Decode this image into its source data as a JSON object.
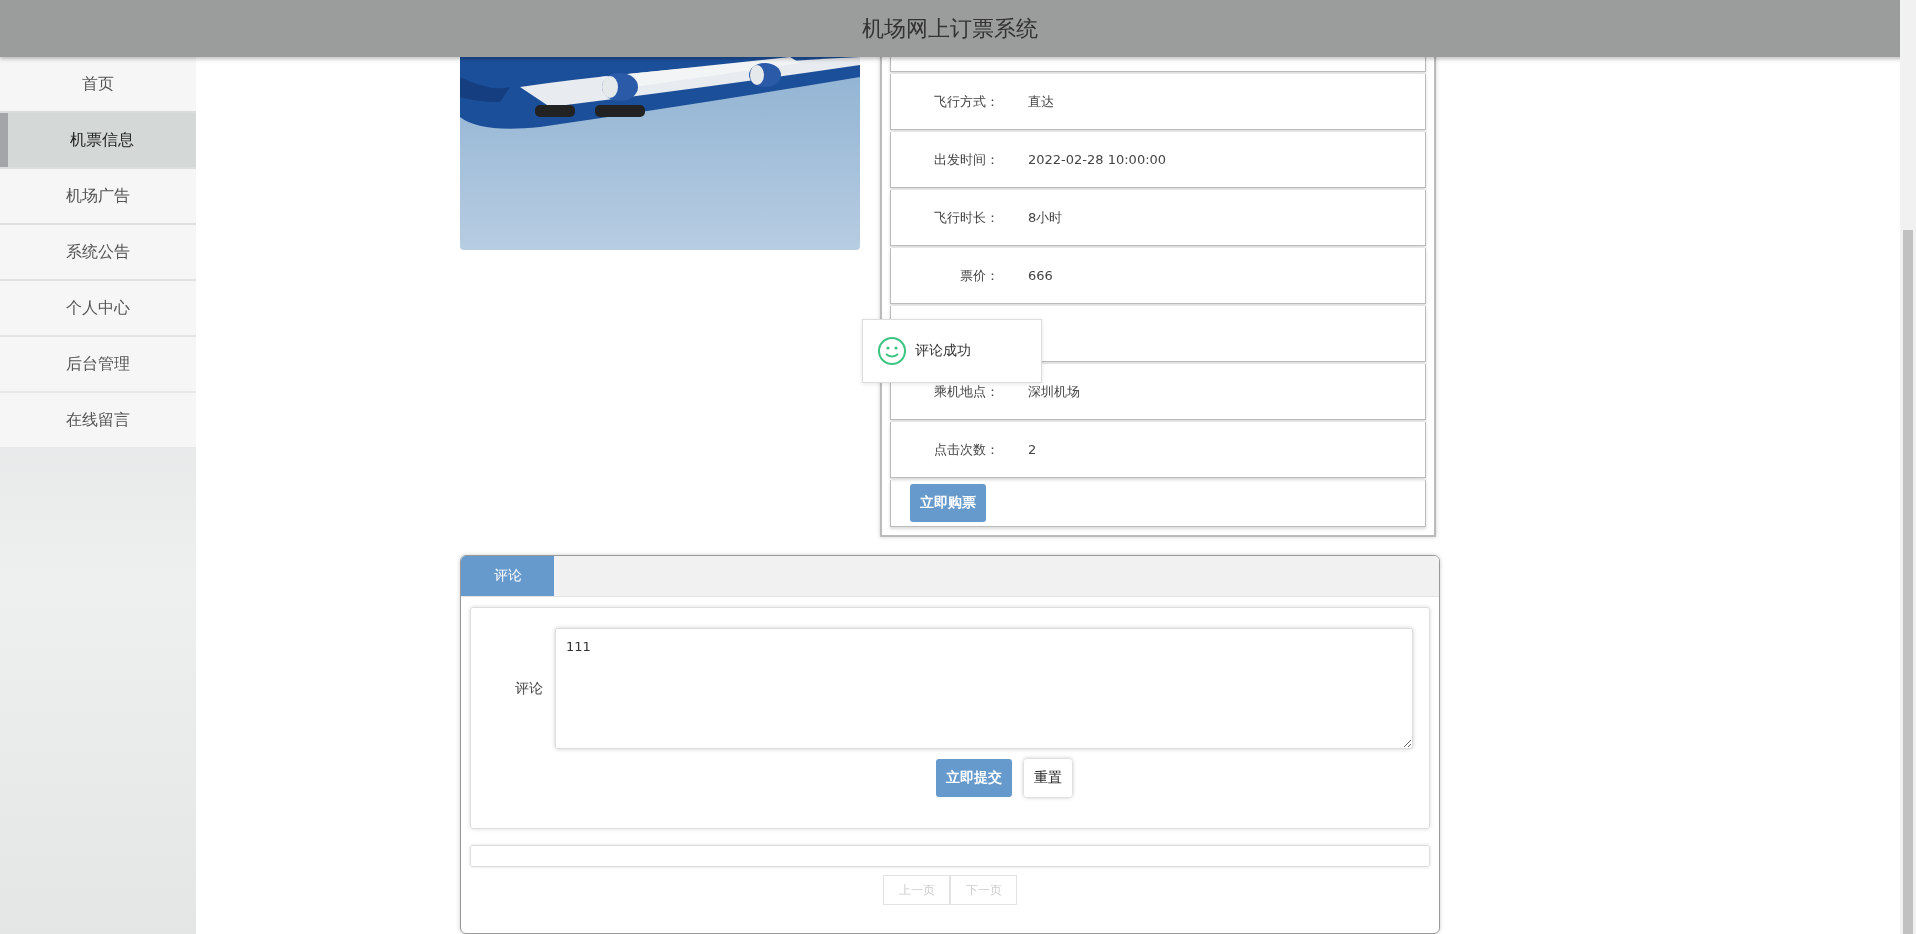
{
  "header": {
    "title": "机场网上订票系统"
  },
  "sidebar": {
    "items": [
      {
        "label": "首页",
        "selected": false
      },
      {
        "label": "机票信息",
        "selected": true
      },
      {
        "label": "机场广告",
        "selected": false
      },
      {
        "label": "系统公告",
        "selected": false
      },
      {
        "label": "个人中心",
        "selected": false
      },
      {
        "label": "后台管理",
        "selected": false
      },
      {
        "label": "在线留言",
        "selected": false
      }
    ]
  },
  "detail": {
    "rows": [
      {
        "kind": "field",
        "label": "飞行方式：",
        "value": "直达"
      },
      {
        "kind": "field",
        "label": "出发时间：",
        "value": "2022-02-28 10:00:00"
      },
      {
        "kind": "field",
        "label": "飞行时长：",
        "value": "8小时"
      },
      {
        "kind": "field",
        "label": "票价：",
        "value": "666"
      },
      {
        "kind": "covered"
      },
      {
        "kind": "field",
        "label": "乘机地点：",
        "value": "深圳机场"
      },
      {
        "kind": "field",
        "label": "点击次数：",
        "value": "2"
      }
    ],
    "buy_button": "立即购票"
  },
  "toast": {
    "message": "评论成功"
  },
  "comments": {
    "tabs": [
      {
        "label": "评论",
        "selected": true
      }
    ],
    "form": {
      "label": "评论",
      "value": "111",
      "submit": "立即提交",
      "reset": "重置"
    },
    "pagination": {
      "prev": "上一页",
      "next": "下一页"
    }
  }
}
